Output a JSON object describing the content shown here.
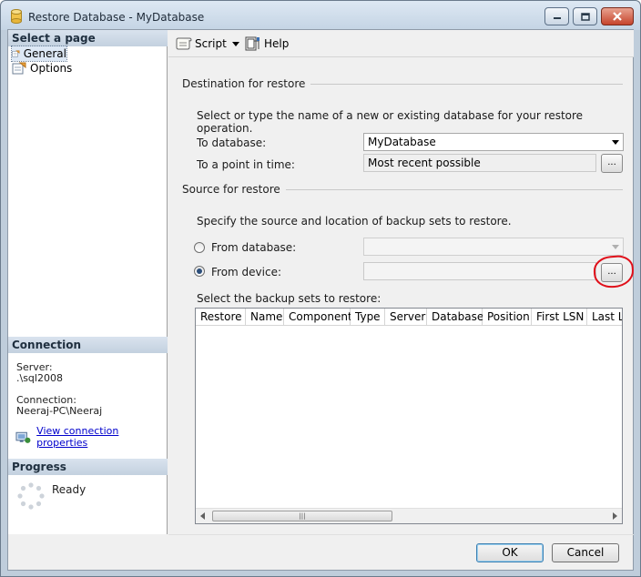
{
  "window": {
    "title": "Restore Database - MyDatabase"
  },
  "left_pane": {
    "select_page_header": "Select a page",
    "pages": [
      {
        "label": "General",
        "icon": "page-icon"
      },
      {
        "label": "Options",
        "icon": "page-icon"
      }
    ],
    "connection_header": "Connection",
    "server_label": "Server:",
    "server_value": ".\\sql2008",
    "connection_label": "Connection:",
    "connection_value": "Neeraj-PC\\Neeraj",
    "view_connection_link": "View connection properties",
    "progress_header": "Progress",
    "progress_status": "Ready"
  },
  "toolbar": {
    "script_label": "Script",
    "help_label": "Help"
  },
  "destination": {
    "group_label": "Destination for restore",
    "instruction": "Select or type the name of a new or existing database for your restore operation.",
    "to_database_label": "To database:",
    "to_database_value": "MyDatabase",
    "point_in_time_label": "To a point in time:",
    "point_in_time_value": "Most recent possible",
    "browse_label": "..."
  },
  "source": {
    "group_label": "Source for restore",
    "instruction": "Specify the source and location of backup sets to restore.",
    "from_database_label": "From database:",
    "from_device_label": "From device:",
    "from_device_selected": true,
    "browse_label": "...",
    "backup_sets_label": "Select the backup sets to restore:",
    "columns": [
      "Restore",
      "Name",
      "Component",
      "Type",
      "Server",
      "Database",
      "Position",
      "First LSN",
      "Last LSN"
    ],
    "rows": []
  },
  "footer": {
    "ok_label": "OK",
    "cancel_label": "Cancel"
  },
  "colors": {
    "annotation_red": "#e0101a",
    "link": "#0000cc",
    "header_band": "#c3d1df"
  }
}
